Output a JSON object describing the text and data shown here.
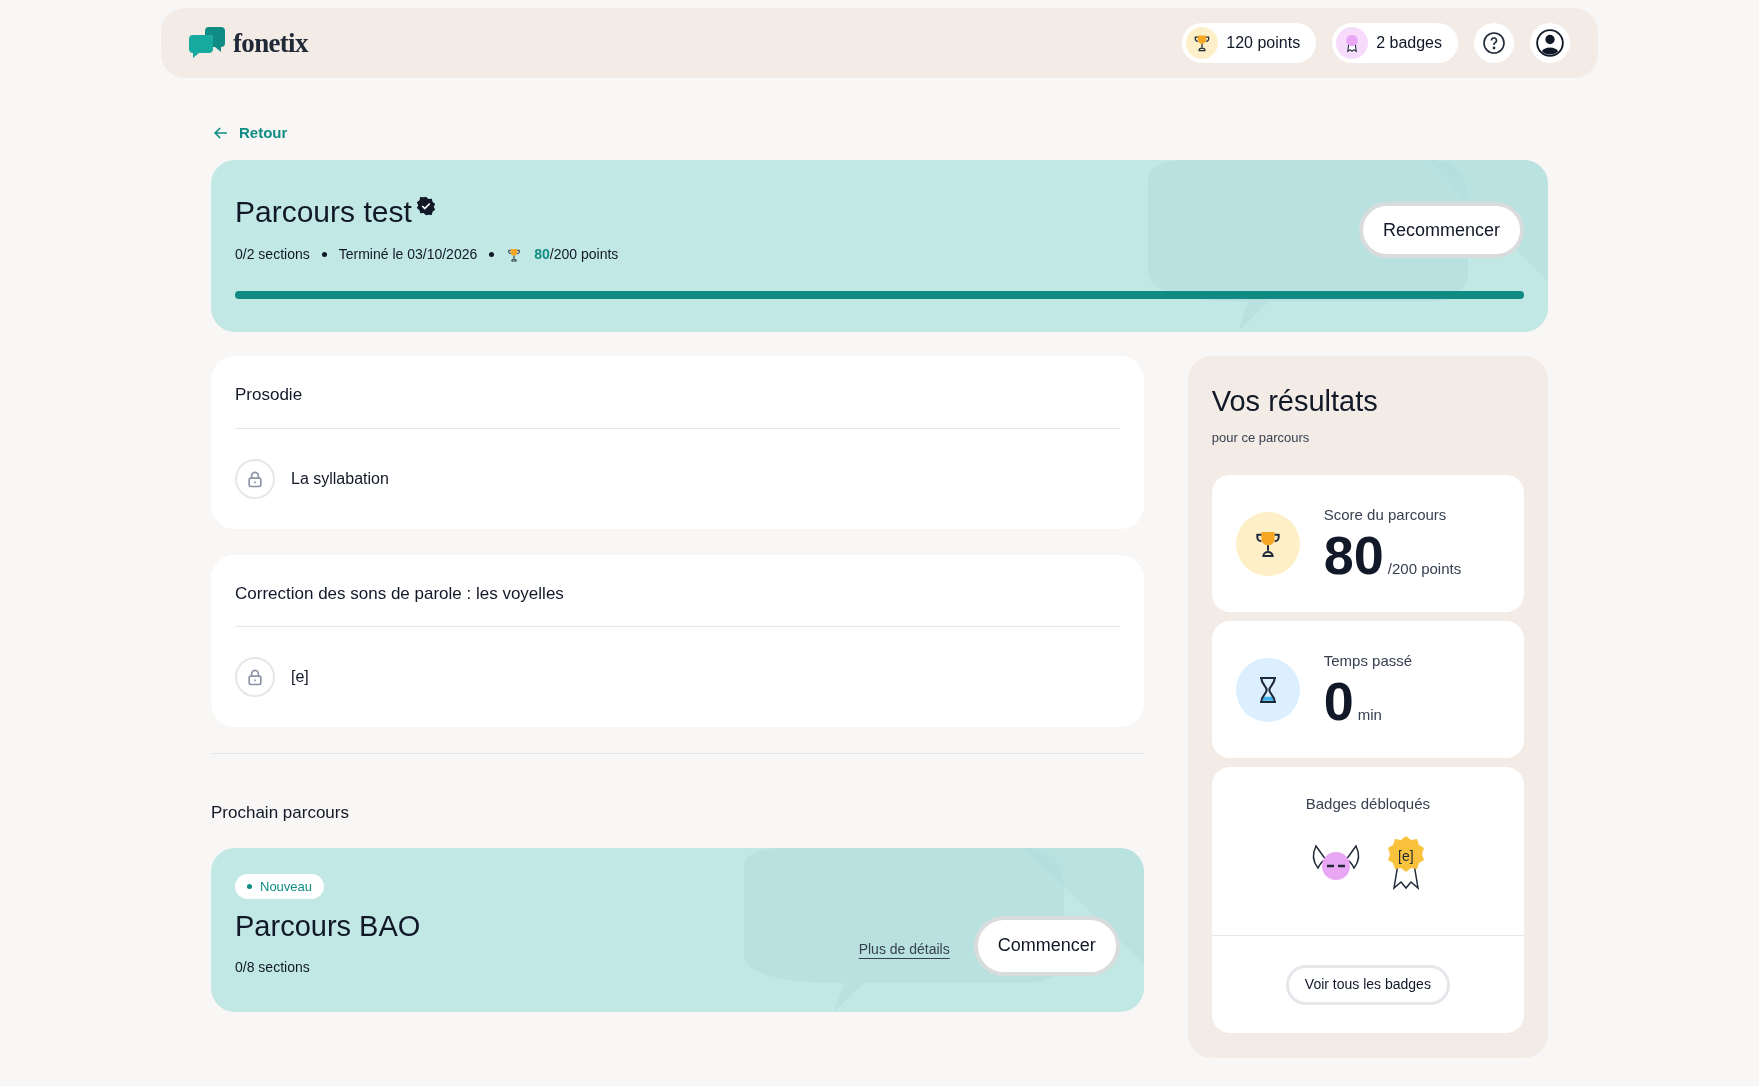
{
  "header": {
    "logo": "fonetix",
    "points": "120 points",
    "badges": "2 badges"
  },
  "back_link": "Retour",
  "course": {
    "title": "Parcours test",
    "verified": true,
    "sections": "0/2 sections",
    "finished": "Terminé le 03/10/2026",
    "score": "80",
    "score_total": "/200 points",
    "level": 1,
    "button": "Recommencer"
  },
  "sections": [
    {
      "title": "Prosodie",
      "items": [
        {
          "label": "La syllabation",
          "locked": true
        }
      ]
    },
    {
      "title": "Correction des sons de parole : les voyelles",
      "items": [
        {
          "label": "[e]",
          "locked": true
        }
      ]
    }
  ],
  "next": {
    "heading": "Prochain parcours",
    "tag": "Nouveau",
    "title": "Parcours BAO",
    "sections": "0/8 sections",
    "details_link": "Plus de détails",
    "button": "Commencer"
  },
  "results": {
    "title": "Vos résultats",
    "subtitle": "pour ce parcours",
    "stats": [
      {
        "kind": "score",
        "label": "Score du parcours",
        "value": "80",
        "unit": "/200 points"
      },
      {
        "kind": "time",
        "label": "Temps passé",
        "value": "0",
        "unit": "min"
      }
    ],
    "badges_title": "Badges débloqués",
    "badges": [
      {
        "kind": "wings"
      },
      {
        "kind": "seal",
        "text": "[e]"
      }
    ],
    "all_badges_button": "Voir tous les badges"
  }
}
